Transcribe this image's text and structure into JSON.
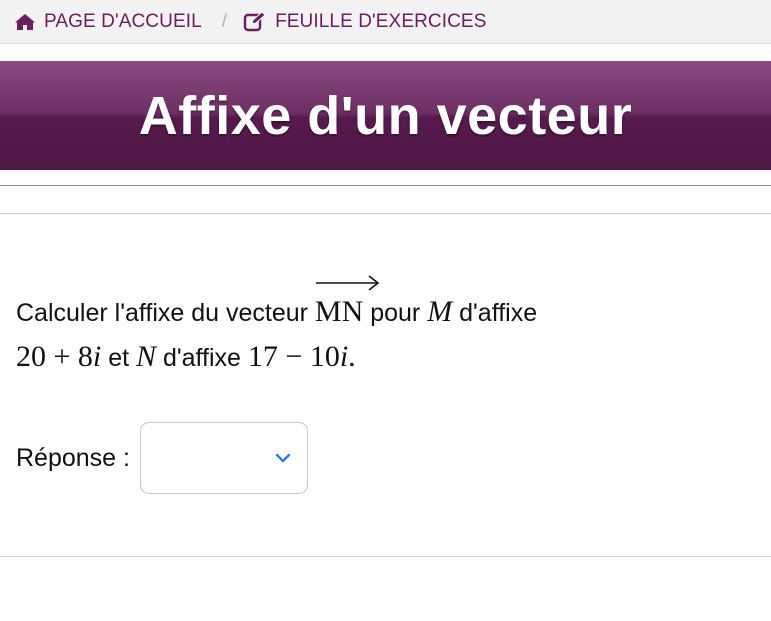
{
  "nav": {
    "home_label": "PAGE D'ACCUEIL",
    "separator": "/",
    "exercises_label": "FEUILLE D'EXERCICES"
  },
  "banner": {
    "title": "Affixe d'un vecteur"
  },
  "question": {
    "part1": "Calculer l'affixe du vecteur ",
    "vector": "MN",
    "part2": " pour ",
    "point_m": "M",
    "part3": " d'affixe",
    "affix_m_re": "20",
    "affix_m_op": "+",
    "affix_m_im": "8",
    "affix_m_i": "i",
    "part4": " et ",
    "point_n": "N",
    "part5": " d'affixe ",
    "affix_n_re": "17",
    "affix_n_op": "−",
    "affix_n_im": "10",
    "affix_n_i": "i",
    "part6": "."
  },
  "answer": {
    "label": "Réponse :",
    "selected_value": ""
  },
  "icons": {
    "home": "home-icon",
    "edit": "edit-icon",
    "chevron": "chevron-down-icon"
  },
  "colors": {
    "nav_link": "#6a1f5d",
    "banner_top": "#8a4a7f",
    "banner_bottom": "#4e1744",
    "chevron": "#2f7de1"
  }
}
